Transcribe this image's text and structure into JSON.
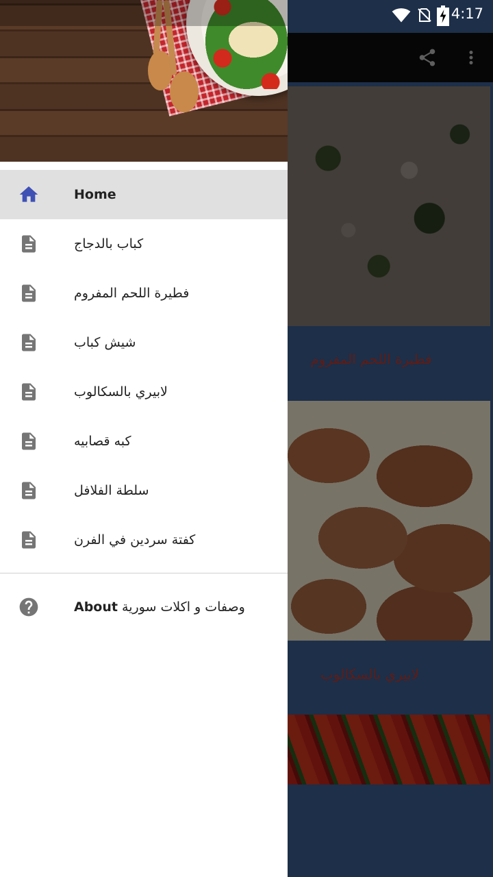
{
  "status_bar": {
    "time": "4:17",
    "icons": [
      "image-notification-icon",
      "wifi-icon",
      "no-sim-icon",
      "battery-charging-icon"
    ]
  },
  "toolbar": {
    "icons": [
      "share-icon",
      "more-vert-icon"
    ]
  },
  "background_cards": [
    {
      "title": "فطيرة اللحم المفروم",
      "image": "spinach-pie-photo"
    },
    {
      "title": "لابيري بالسكالوب",
      "image": "chicken-scallop-photo"
    },
    {
      "image": "red-pepper-salad-photo"
    }
  ],
  "drawer": {
    "header_image": "food-table-photo",
    "items": [
      {
        "label": "Home",
        "icon": "home-icon",
        "active": true
      },
      {
        "label": "كباب بالدجاج",
        "icon": "document-icon"
      },
      {
        "label": "فطيرة اللحم المفروم",
        "icon": "document-icon"
      },
      {
        "label": "شيش كباب",
        "icon": "document-icon"
      },
      {
        "label": "لابيري بالسكالوب",
        "icon": "document-icon"
      },
      {
        "label": "كبه قصابيه",
        "icon": "document-icon"
      },
      {
        "label": "سلطة الفلافل",
        "icon": "document-icon"
      },
      {
        "label": "كفتة سردين في الفرن",
        "icon": "document-icon"
      }
    ],
    "about": {
      "prefix": "About",
      "app_name": "وصفات و اكلات سورية",
      "icon": "help-icon"
    }
  },
  "colors": {
    "accent": "#3f51b5",
    "icon_gray": "#757575",
    "background_blue": "#3a5f93",
    "card_title": "#c0392b",
    "active_item": "#e0e0e0"
  }
}
